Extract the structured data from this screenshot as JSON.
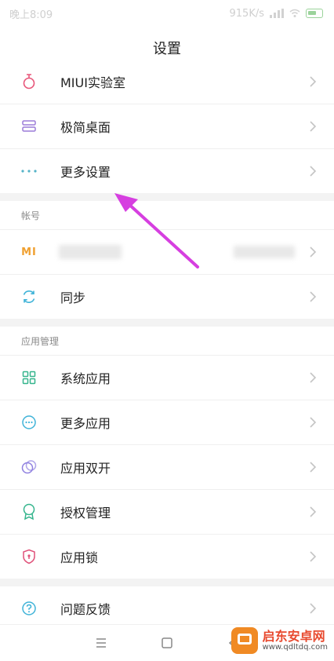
{
  "status": {
    "time": "晚上8:09",
    "speed": "915K/s"
  },
  "header": {
    "title": "设置"
  },
  "group1": [
    {
      "label": "MIUI实验室",
      "icon": "flask-icon",
      "color": "#e8567a"
    },
    {
      "label": "极简桌面",
      "icon": "layout-icon",
      "color": "#9c7cd8"
    },
    {
      "label": "更多设置",
      "icon": "more-dots-icon",
      "color": "#55b3c8"
    }
  ],
  "account": {
    "section_title": "帐号",
    "mi_account": {
      "icon": "mi-logo-icon",
      "logo_text": "MI",
      "color": "#f0a030"
    },
    "sync": {
      "label": "同步",
      "icon": "sync-icon",
      "color": "#3fb3d8"
    }
  },
  "apps": {
    "section_title": "应用管理",
    "items": [
      {
        "label": "系统应用",
        "icon": "grid-icon",
        "color": "#35b58d"
      },
      {
        "label": "更多应用",
        "icon": "more-circle-icon",
        "color": "#3fb3d8"
      },
      {
        "label": "应用双开",
        "icon": "dual-circle-icon",
        "color": "#8e7fe0"
      },
      {
        "label": "授权管理",
        "icon": "badge-icon",
        "color": "#35b58d"
      },
      {
        "label": "应用锁",
        "icon": "shield-icon",
        "color": "#e0527a"
      }
    ]
  },
  "feedback": {
    "label": "问题反馈",
    "icon": "help-icon",
    "color": "#3fb3d8"
  },
  "watermark": {
    "title": "启东安卓网",
    "url": "www.qdltdq.com"
  }
}
